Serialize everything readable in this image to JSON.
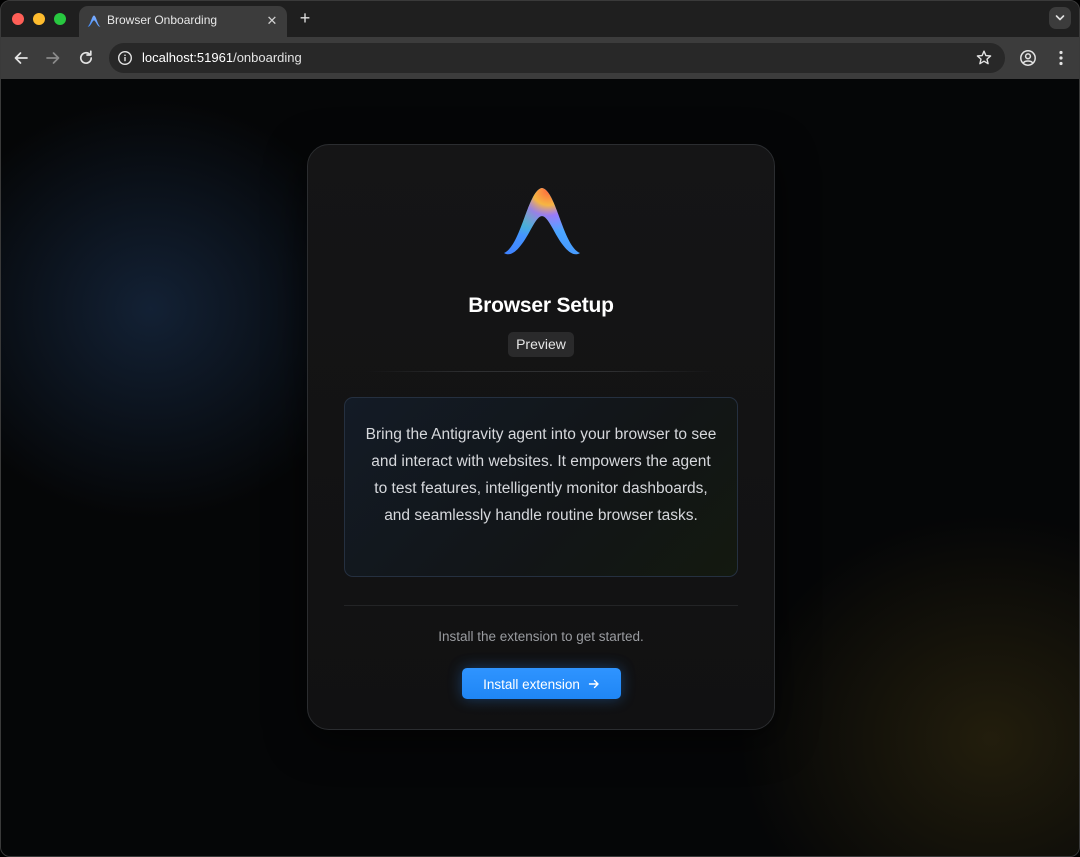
{
  "tab": {
    "title": "Browser Onboarding",
    "close_glyph": "✕",
    "new_tab_glyph": "+"
  },
  "omnibox": {
    "url_host": "localhost:51961",
    "url_path": "/onboarding"
  },
  "card": {
    "title": "Browser Setup",
    "badge": "Preview",
    "description": "Bring the Antigravity agent into your browser to see and interact with websites. It empowers the agent to test features, intelligently monitor dashboards, and seamlessly handle routine browser tasks.",
    "install_hint": "Install the extension to get started.",
    "install_button_label": "Install extension"
  },
  "icons": {
    "back": "arrow-left-icon",
    "forward": "arrow-right-icon",
    "reload": "reload-icon",
    "site_info": "info-icon",
    "bookmark": "star-icon",
    "profile": "profile-icon",
    "menu": "kebab-menu-icon",
    "tab_search": "chevron-down-icon",
    "install_arrow": "arrow-right-icon"
  },
  "colors": {
    "accent_button": "#2f94ff",
    "card_background": "#151516",
    "page_background": "#050607"
  }
}
